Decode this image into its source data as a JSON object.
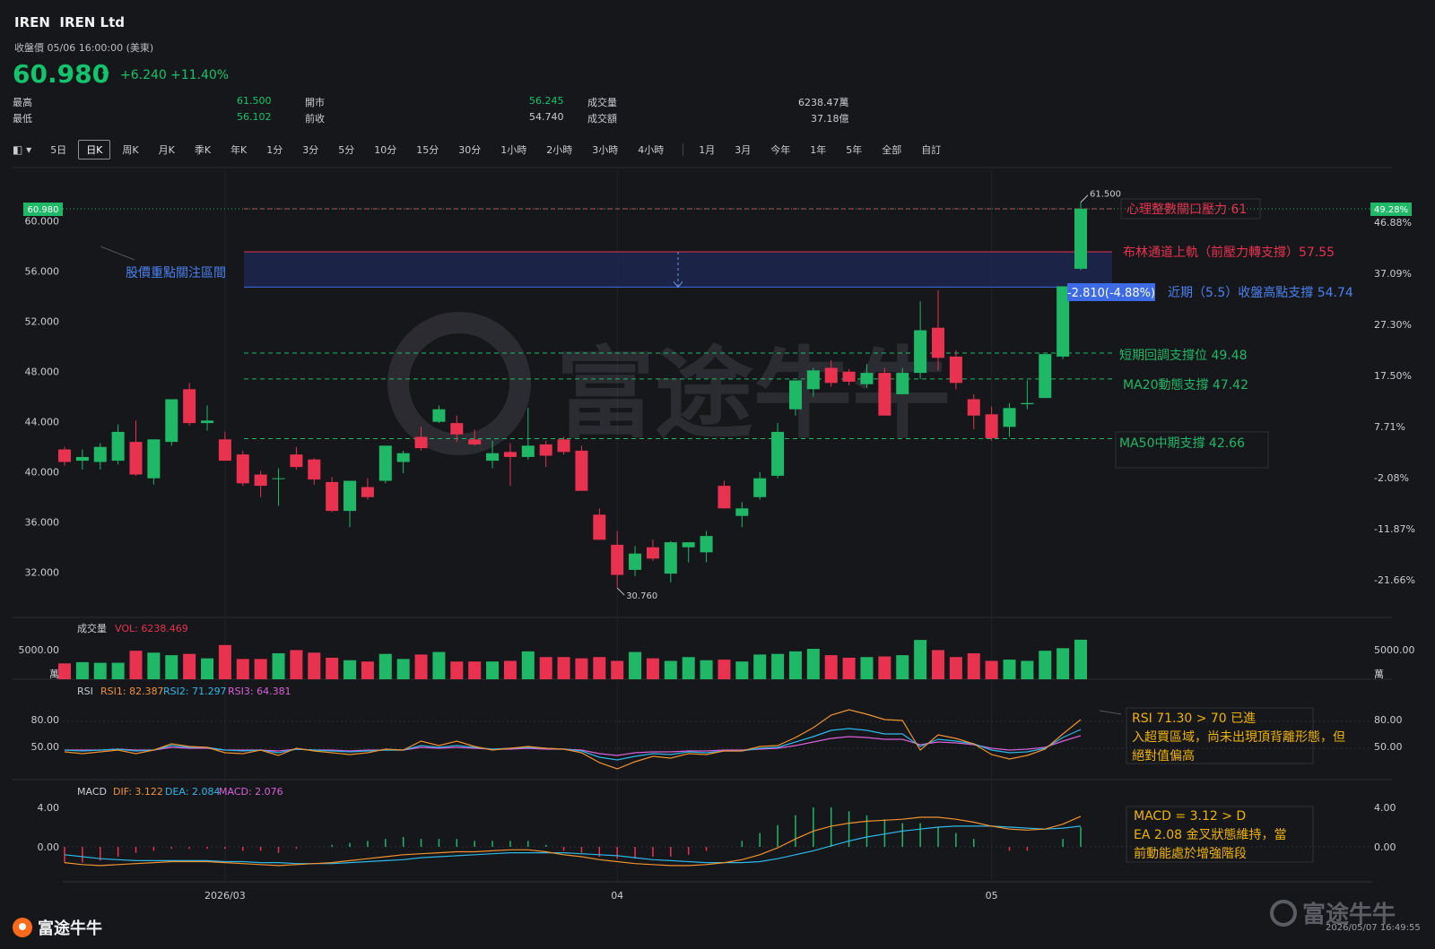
{
  "header": {
    "ticker": "IREN",
    "name": "IREN Ltd",
    "close_label": "收盤價 05/06 16:00:00 (美東)",
    "price": "60.980",
    "change": "+6.240",
    "change_pct": "+11.40%",
    "stats": {
      "high_label": "最高",
      "high": "61.500",
      "low_label": "最低",
      "low": "56.102",
      "open_label": "開市",
      "open": "56.245",
      "prev_label": "前收",
      "prev": "54.740",
      "vol_label": "成交量",
      "vol": "6238.47萬",
      "amt_label": "成交額",
      "amt": "37.18億"
    }
  },
  "tabs": [
    "5日",
    "日K",
    "周K",
    "月K",
    "季K",
    "年K",
    "1分",
    "3分",
    "5分",
    "10分",
    "15分",
    "30分",
    "1小時",
    "2小時",
    "3小時",
    "4小時",
    "1月",
    "3月",
    "今年",
    "1年",
    "5年",
    "全部",
    "自訂"
  ],
  "active_tab": "日K",
  "footer": {
    "brand": "富途牛牛",
    "watermark": "富途牛牛",
    "timestamp": "2026/05/07 16:49:55"
  },
  "colors": {
    "up": "#1fb866",
    "down": "#e8324f",
    "bg": "#16171b",
    "accent_blue": "#3d6be6"
  },
  "chart_data": {
    "type": "candlestick",
    "x_ticks": [
      {
        "label": "2026/03",
        "index": 9
      },
      {
        "label": "04",
        "index": 31
      },
      {
        "label": "05",
        "index": 52
      }
    ],
    "ylim": [
      29,
      62.6
    ],
    "y_ticks": [
      "60.000",
      "56.000",
      "52.000",
      "48.000",
      "44.000",
      "40.000",
      "36.000",
      "32.000"
    ],
    "pct_ticks": [
      "49.28%",
      "46.88%",
      "37.09%",
      "27.30%",
      "17.50%",
      "7.71%",
      "-2.08%",
      "-11.87%",
      "-21.66%"
    ],
    "last_price_label": "60.980",
    "last_pct_label": "49.28%",
    "max_label": "61.500",
    "min_label": "30.760",
    "candles": [
      [
        41.8,
        42.0,
        40.5,
        40.8
      ],
      [
        40.9,
        41.8,
        40.2,
        41.2
      ],
      [
        40.8,
        42.3,
        40.2,
        42.0
      ],
      [
        40.9,
        43.8,
        40.6,
        43.2
      ],
      [
        42.4,
        44.1,
        39.7,
        39.8
      ],
      [
        39.5,
        42.6,
        39.0,
        42.6
      ],
      [
        42.4,
        45.8,
        42.1,
        45.8
      ],
      [
        46.6,
        47.1,
        43.7,
        43.9
      ],
      [
        43.9,
        45.3,
        43.3,
        44.1
      ],
      [
        42.6,
        43.2,
        40.9,
        40.9
      ],
      [
        41.4,
        41.7,
        38.9,
        39.1
      ],
      [
        39.8,
        40.1,
        38.0,
        38.9
      ],
      [
        39.5,
        40.3,
        37.3,
        39.5
      ],
      [
        41.4,
        42.0,
        40.2,
        40.4
      ],
      [
        41.0,
        41.1,
        39.0,
        39.4
      ],
      [
        39.2,
        39.6,
        36.8,
        36.9
      ],
      [
        36.9,
        39.3,
        35.6,
        39.3
      ],
      [
        38.8,
        39.5,
        37.8,
        38.0
      ],
      [
        39.3,
        41.9,
        39.1,
        42.1
      ],
      [
        40.8,
        41.7,
        39.9,
        41.5
      ],
      [
        42.8,
        43.6,
        41.7,
        41.9
      ],
      [
        44.0,
        45.3,
        43.9,
        45.0
      ],
      [
        43.9,
        44.5,
        42.4,
        43.0
      ],
      [
        42.6,
        43.4,
        42.1,
        42.2
      ],
      [
        40.9,
        42.5,
        40.3,
        41.5
      ],
      [
        41.6,
        42.3,
        38.9,
        41.2
      ],
      [
        41.2,
        45.1,
        41.0,
        42.1
      ],
      [
        42.2,
        42.5,
        40.4,
        41.3
      ],
      [
        42.6,
        42.8,
        41.4,
        41.6
      ],
      [
        41.7,
        42.1,
        38.6,
        38.5
      ],
      [
        36.6,
        37.1,
        34.6,
        34.6
      ],
      [
        34.2,
        35.3,
        30.8,
        31.8
      ],
      [
        32.2,
        34.1,
        31.7,
        33.5
      ],
      [
        34.0,
        34.6,
        32.9,
        33.1
      ],
      [
        31.9,
        34.5,
        31.2,
        34.4
      ],
      [
        34.0,
        34.3,
        32.8,
        34.4
      ],
      [
        33.6,
        35.3,
        32.8,
        34.9
      ],
      [
        38.9,
        39.3,
        37.1,
        37.1
      ],
      [
        36.5,
        37.6,
        35.6,
        37.1
      ],
      [
        38.0,
        40.0,
        37.8,
        39.5
      ],
      [
        39.7,
        43.9,
        39.5,
        43.2
      ],
      [
        45.0,
        47.0,
        44.5,
        47.3
      ],
      [
        46.6,
        48.3,
        46.0,
        48.1
      ],
      [
        48.3,
        48.9,
        46.8,
        47.1
      ],
      [
        48.0,
        48.2,
        46.9,
        47.2
      ],
      [
        47.0,
        48.6,
        46.7,
        47.9
      ],
      [
        47.9,
        48.3,
        44.5,
        44.5
      ],
      [
        46.2,
        48.3,
        46.2,
        47.9
      ],
      [
        47.9,
        53.6,
        47.4,
        51.3
      ],
      [
        51.5,
        54.5,
        48.1,
        49.1
      ],
      [
        49.2,
        49.7,
        46.6,
        47.1
      ],
      [
        45.8,
        46.2,
        43.4,
        44.5
      ],
      [
        44.6,
        45.2,
        42.5,
        42.7
      ],
      [
        43.6,
        45.5,
        42.8,
        45.1
      ],
      [
        45.4,
        47.3,
        45.0,
        45.5
      ],
      [
        45.9,
        49.3,
        45.9,
        49.4
      ],
      [
        49.2,
        51.2,
        49.0,
        54.8
      ],
      [
        56.2,
        61.5,
        56.1,
        60.98
      ]
    ],
    "volume": {
      "label": "成交量",
      "vol_text": "VOL: 6238.469",
      "tick_label": "5000.00",
      "unit": "萬",
      "values": [
        2500,
        2700,
        2600,
        2600,
        4500,
        4200,
        3800,
        4000,
        3300,
        5400,
        3200,
        3200,
        4100,
        4600,
        4200,
        3400,
        3000,
        2800,
        4000,
        3200,
        3900,
        4300,
        2800,
        2800,
        2800,
        2900,
        4400,
        3500,
        3500,
        3300,
        3500,
        2900,
        4300,
        3300,
        2900,
        3500,
        3000,
        3100,
        2800,
        3900,
        4000,
        4400,
        4800,
        3800,
        3400,
        3500,
        3600,
        3800,
        6200,
        4600,
        3500,
        4100,
        2900,
        3100,
        2900,
        4500,
        4900,
        6238
      ]
    },
    "rsi": {
      "label": "RSI",
      "rsi1_text": "RSI1: 82.387",
      "rsi2_text": "RSI2: 71.297",
      "rsi3_text": "RSI3: 64.381",
      "ticks": [
        "80.00",
        "50.00"
      ],
      "rsi1": [
        46,
        44,
        46,
        48,
        44,
        48,
        55,
        52,
        51,
        45,
        44,
        48,
        42,
        50,
        47,
        45,
        43,
        45,
        49,
        48,
        58,
        53,
        58,
        52,
        48,
        50,
        52,
        50,
        49,
        45,
        34,
        27,
        35,
        41,
        39,
        44,
        43,
        47,
        47,
        52,
        53,
        62,
        73,
        87,
        93,
        88,
        82,
        81,
        48,
        65,
        61,
        55,
        43,
        38,
        42,
        49,
        66,
        82
      ],
      "rsi2": [
        48,
        47,
        48,
        49,
        47,
        48,
        53,
        51,
        51,
        48,
        47,
        48,
        45,
        49,
        48,
        47,
        46,
        47,
        48,
        48,
        53,
        51,
        53,
        51,
        49,
        50,
        51,
        50,
        49,
        47,
        40,
        37,
        41,
        44,
        43,
        46,
        45,
        47,
        47,
        50,
        51,
        57,
        63,
        70,
        72,
        70,
        66,
        66,
        52,
        60,
        58,
        55,
        48,
        45,
        46,
        50,
        62,
        71
      ],
      "rsi3": [
        48,
        48,
        48,
        49,
        48,
        48,
        51,
        50,
        50,
        48,
        48,
        48,
        47,
        49,
        48,
        48,
        47,
        48,
        48,
        48,
        51,
        50,
        51,
        50,
        49,
        49,
        50,
        49,
        49,
        48,
        44,
        42,
        45,
        46,
        46,
        47,
        47,
        48,
        48,
        49,
        50,
        53,
        57,
        61,
        63,
        62,
        60,
        60,
        54,
        57,
        56,
        54,
        50,
        48,
        49,
        51,
        58,
        64
      ]
    },
    "macd": {
      "label": "MACD",
      "dif_text": "DIF: 3.122",
      "dea_text": "DEA: 2.084",
      "macd_text": "MACD: 2.076",
      "ticks": [
        "4.00",
        "0.00"
      ],
      "dif": [
        -1.6,
        -1.8,
        -1.9,
        -1.8,
        -1.7,
        -1.6,
        -1.5,
        -1.5,
        -1.5,
        -1.6,
        -1.7,
        -1.8,
        -1.9,
        -1.8,
        -1.7,
        -1.6,
        -1.4,
        -1.2,
        -1.0,
        -0.8,
        -0.7,
        -0.6,
        -0.5,
        -0.5,
        -0.4,
        -0.3,
        -0.3,
        -0.5,
        -0.8,
        -1.0,
        -1.3,
        -1.5,
        -1.7,
        -1.8,
        -1.9,
        -1.9,
        -1.8,
        -1.6,
        -1.3,
        -0.8,
        -0.1,
        0.8,
        1.6,
        2.1,
        2.4,
        2.6,
        2.7,
        2.8,
        3.0,
        3.0,
        2.8,
        2.5,
        2.1,
        1.8,
        1.7,
        1.8,
        2.3,
        3.1
      ],
      "dea": [
        -0.8,
        -1.0,
        -1.2,
        -1.3,
        -1.4,
        -1.4,
        -1.4,
        -1.4,
        -1.4,
        -1.5,
        -1.5,
        -1.6,
        -1.6,
        -1.7,
        -1.7,
        -1.7,
        -1.6,
        -1.5,
        -1.4,
        -1.3,
        -1.1,
        -1.0,
        -0.9,
        -0.8,
        -0.7,
        -0.6,
        -0.6,
        -0.6,
        -0.6,
        -0.7,
        -0.8,
        -0.9,
        -1.1,
        -1.3,
        -1.4,
        -1.5,
        -1.6,
        -1.6,
        -1.6,
        -1.5,
        -1.2,
        -0.8,
        -0.4,
        0.1,
        0.6,
        1.0,
        1.3,
        1.6,
        1.8,
        2.0,
        2.1,
        2.1,
        2.1,
        2.0,
        1.9,
        1.8,
        1.9,
        2.1
      ]
    },
    "annotations": {
      "zone_label": "股價重點關注區間",
      "zone_change": "-2.810(-4.88%)",
      "line1": "心理整數關口壓力 61",
      "line2": "布林通道上軌（前壓力轉支撐）57.55",
      "line3": "近期（5.5）收盤高點支撐 54.74",
      "line4": "短期回調支撐位 49.48",
      "line5": "MA20動態支撐 47.42",
      "line6": "MA50中期支撐 42.66",
      "rsi_note": "RSI 71.30 > 70 已進入超買區域，尚未出現頂背離形態，但絕對值偏高",
      "macd_note": "MACD = 3.12 >  DEA 2.08 金叉狀態維持，當前動能處於增強階段"
    }
  }
}
